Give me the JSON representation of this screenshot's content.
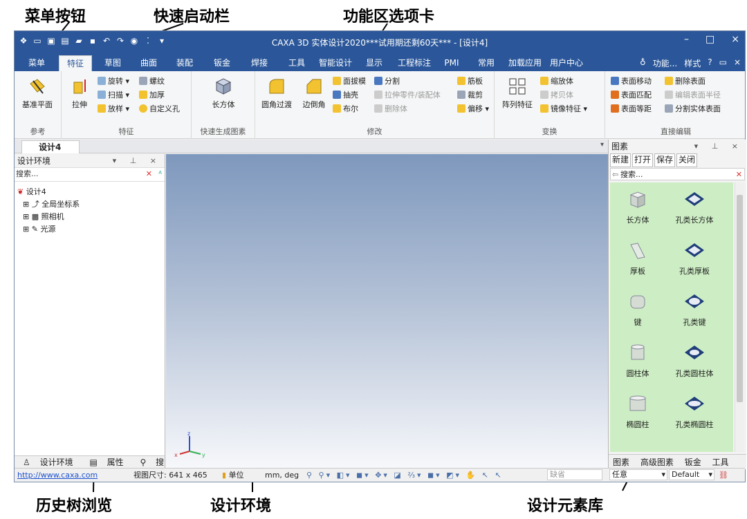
{
  "annotations": {
    "menu_button": "菜单按钮",
    "quick_launch": "快速启动栏",
    "ribbon_tabs": "功能区选项卡",
    "history_tree": "历史树浏览",
    "design_env": "设计环境",
    "element_library": "设计元素库"
  },
  "window": {
    "title": "CAXA 3D 实体设计2020***试用期还剩60天*** - [设计4]"
  },
  "tabs": [
    "菜单",
    "特征",
    "草图",
    "曲面",
    "装配",
    "钣金",
    "焊接",
    "工具",
    "智能设计",
    "显示",
    "工程标注",
    "PMI",
    "常用",
    "加载应用",
    "用户中心"
  ],
  "active_tab": "特征",
  "tab_right": {
    "func": "功能...",
    "style": "样式"
  },
  "ribbon": {
    "groups": {
      "ref": "参考",
      "feature": "特征",
      "quick": "快速生成图素",
      "modify": "修改",
      "transform": "变换",
      "direct": "直接编辑"
    },
    "ref_btn": "基准平面",
    "stretch": "拉伸",
    "rotate": "旋转",
    "sweep": "扫描",
    "loft": "放样",
    "thread": "螺纹",
    "thicken": "加厚",
    "custom_hole": "自定义孔",
    "cuboid": "长方体",
    "fillet": "圆角过渡",
    "chamfer": "边倒角",
    "draft": "面拔模",
    "shell": "抽壳",
    "boolean": "布尔",
    "split": "分割",
    "stretch_part": "拉伸零件/装配体",
    "delete_body": "删除体",
    "rib": "筋板",
    "trim": "裁剪",
    "offset": "偏移",
    "pattern": "阵列特征",
    "scale": "缩放体",
    "copy": "拷贝体",
    "mirror": "镜像特征",
    "move_face": "表面移动",
    "match_face": "表面匹配",
    "equal_face": "表面等距",
    "delete_face": "删除表面",
    "edit_radius": "编辑表面半径",
    "split_body": "分割实体表面"
  },
  "doc_tab": "设计4",
  "left_panel": {
    "title": "设计环境",
    "search_placeholder": "搜索...",
    "tree": [
      "设计4",
      "全局坐标系",
      "照相机",
      "光源"
    ],
    "tabs": [
      "设计环境",
      "属性",
      "搜索"
    ]
  },
  "right_panel": {
    "title": "图素",
    "buttons": [
      "新建",
      "打开",
      "保存",
      "关闭"
    ],
    "search_placeholder": "搜索...",
    "items": [
      "长方体",
      "孔类长方体",
      "厚板",
      "孔类厚板",
      "键",
      "孔类键",
      "圆柱体",
      "孔类圆柱体",
      "椭圆柱",
      "孔类椭圆柱"
    ],
    "tabs": [
      "图素",
      "高级图素",
      "钣金",
      "工具"
    ]
  },
  "status": {
    "url": "http://www.caxa.com",
    "view_size_label": "视图尺寸: 641 x 465",
    "unit_label": "单位",
    "unit_value": "mm, deg",
    "default_input": "缺省",
    "any": "任意",
    "default_select": "Default"
  },
  "colors": {
    "title_bg": "#2b579a",
    "viewport_top": "#7e98bd",
    "library_bg": "#cdeec4"
  }
}
